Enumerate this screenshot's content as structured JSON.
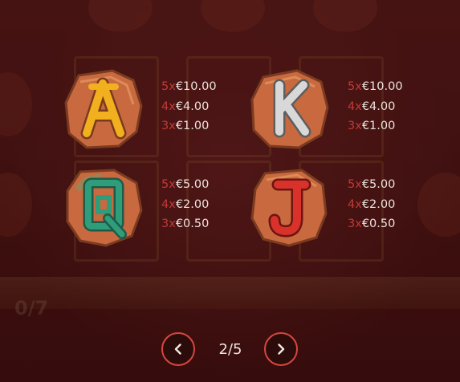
{
  "paytable": {
    "symbols": [
      {
        "id": "A",
        "icon": "letter-a-stone",
        "letter_color": "#f2b01e",
        "pays": [
          {
            "multiplier": "5x",
            "value": "€10.00"
          },
          {
            "multiplier": "4x",
            "value": "€4.00"
          },
          {
            "multiplier": "3x",
            "value": "€1.00"
          }
        ]
      },
      {
        "id": "K",
        "icon": "letter-k-stone",
        "letter_color": "#d8d8d8",
        "pays": [
          {
            "multiplier": "5x",
            "value": "€10.00"
          },
          {
            "multiplier": "4x",
            "value": "€4.00"
          },
          {
            "multiplier": "3x",
            "value": "€1.00"
          }
        ]
      },
      {
        "id": "Q",
        "icon": "letter-q-stone",
        "letter_color": "#2f9c7a",
        "pays": [
          {
            "multiplier": "5x",
            "value": "€5.00"
          },
          {
            "multiplier": "4x",
            "value": "€2.00"
          },
          {
            "multiplier": "3x",
            "value": "€0.50"
          }
        ]
      },
      {
        "id": "J",
        "icon": "letter-j-stone",
        "letter_color": "#d8322b",
        "pays": [
          {
            "multiplier": "5x",
            "value": "€5.00"
          },
          {
            "multiplier": "4x",
            "value": "€2.00"
          },
          {
            "multiplier": "3x",
            "value": "€0.50"
          }
        ]
      }
    ]
  },
  "pagination": {
    "page_indicator": "2/5",
    "prev_icon": "chevron-left-icon",
    "next_icon": "chevron-right-icon"
  },
  "background": {
    "counter_text": "0/7"
  },
  "colors": {
    "multiplier": "#c23a34",
    "amount": "#ece3dc",
    "button_ring": "#d7473f",
    "stone": "#c9693f"
  }
}
